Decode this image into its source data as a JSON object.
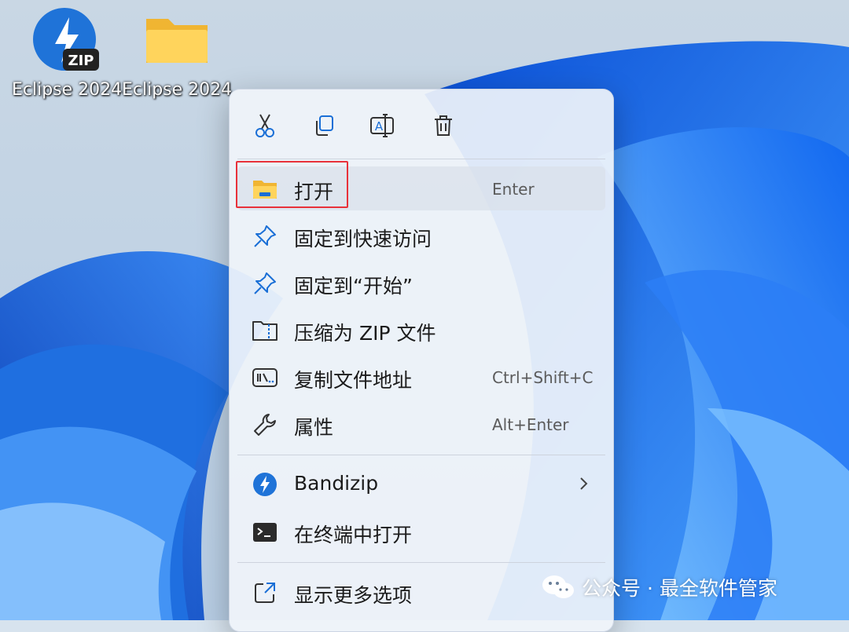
{
  "desktop": {
    "icons": [
      {
        "label": "Eclipse 2024",
        "icon": "zip-archive-icon",
        "badge": "ZIP"
      },
      {
        "label": "Eclipse 2024",
        "icon": "folder-icon"
      }
    ]
  },
  "context_menu": {
    "toolbar": [
      {
        "icon": "cut-icon"
      },
      {
        "icon": "copy-icon"
      },
      {
        "icon": "rename-icon"
      },
      {
        "icon": "delete-icon"
      }
    ],
    "items": [
      {
        "label": "打开",
        "shortcut": "Enter",
        "icon": "folder-open-icon",
        "highlighted": true
      },
      {
        "label": "固定到快速访问",
        "icon": "pin-icon"
      },
      {
        "label": "固定到“开始”",
        "icon": "pin-icon"
      },
      {
        "label": "压缩为 ZIP 文件",
        "icon": "zip-folder-icon"
      },
      {
        "label": "复制文件地址",
        "shortcut": "Ctrl+Shift+C",
        "icon": "copy-path-icon"
      },
      {
        "label": "属性",
        "shortcut": "Alt+Enter",
        "icon": "wrench-icon"
      },
      {
        "label": "Bandizip",
        "icon": "bandizip-icon",
        "has_submenu": true
      },
      {
        "label": "在终端中打开",
        "icon": "terminal-icon"
      },
      {
        "label": "显示更多选项",
        "icon": "share-more-icon"
      }
    ]
  },
  "watermark": {
    "text": "公众号 · 最全软件管家",
    "icon": "wechat-icon"
  },
  "colors": {
    "highlight_border": "#e8313a",
    "wallpaper_blue": "#1f6fe0",
    "menu_background": "#f0f4fa",
    "accent": "#0067c0"
  }
}
